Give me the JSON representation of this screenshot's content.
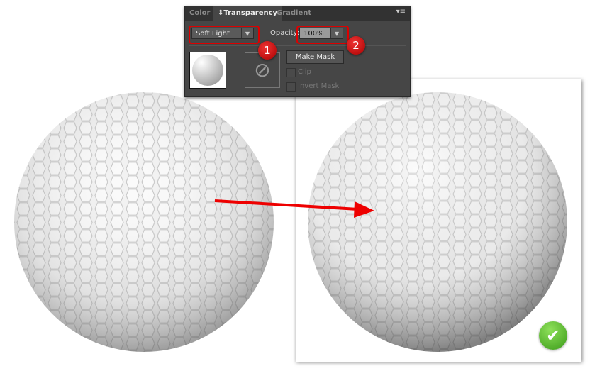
{
  "panel": {
    "tabs": [
      {
        "label": "Color"
      },
      {
        "label": "Transparency"
      },
      {
        "label": "Gradient"
      }
    ],
    "blend_mode": "Soft Light",
    "opacity_label": "Opacity:",
    "opacity_value": "100%",
    "make_mask": "Make Mask",
    "clip": "Clip",
    "invert_mask": "Invert Mask"
  },
  "badges": [
    "1",
    "2"
  ],
  "colors": {
    "highlight": "#dd0000",
    "check": "#4caf28"
  }
}
